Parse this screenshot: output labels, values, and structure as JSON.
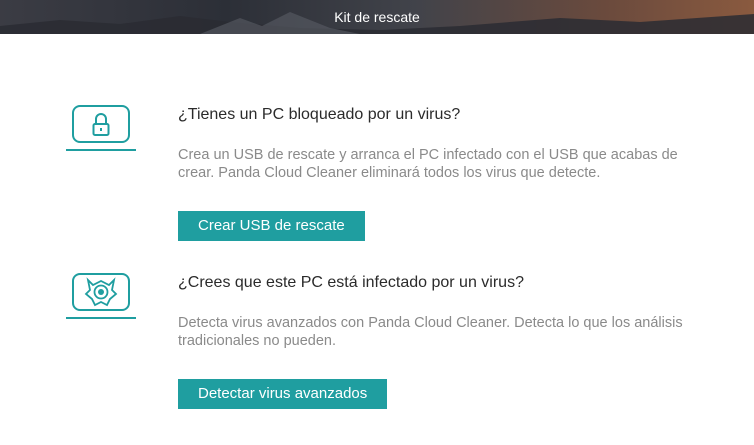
{
  "header": {
    "title": "Kit de rescate"
  },
  "sections": [
    {
      "icon": "lock-icon",
      "title": "¿Tienes un PC bloqueado por un virus?",
      "description": "Crea un USB de rescate y arranca el PC infectado con el USB que acabas de crear. Panda Cloud Cleaner eliminará todos los virus que detecte.",
      "button_label": "Crear USB de rescate"
    },
    {
      "icon": "virus-target-icon",
      "title": "¿Crees que este PC está infectado por un virus?",
      "description": "Detecta virus avanzados con Panda Cloud Cleaner. Detecta lo que los análisis tradicionales no pueden.",
      "button_label": "Detectar virus avanzados"
    }
  ],
  "colors": {
    "accent": "#1f9ea0",
    "title_text": "#2b2b2b",
    "body_text": "#8a8a8a"
  }
}
